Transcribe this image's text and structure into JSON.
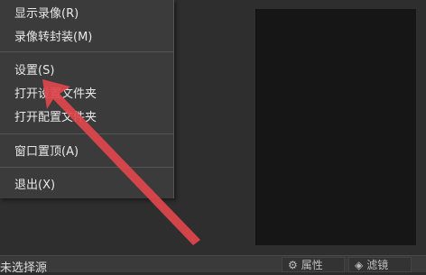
{
  "menu": {
    "items": [
      {
        "label": "显示录像(R)"
      },
      {
        "label": "录像转封装(M)"
      },
      {
        "label": "设置(S)"
      },
      {
        "label": "打开设置文件夹"
      },
      {
        "label": "打开配置文件夹"
      },
      {
        "label": "窗口置顶(A)"
      },
      {
        "label": "退出(X)"
      }
    ]
  },
  "bottom": {
    "source_label": "未选择源",
    "properties_label": "属性",
    "filters_label": "滤镜"
  },
  "annotation": {
    "arrow_color": "#e0474c",
    "icon": "annotation-arrow"
  }
}
